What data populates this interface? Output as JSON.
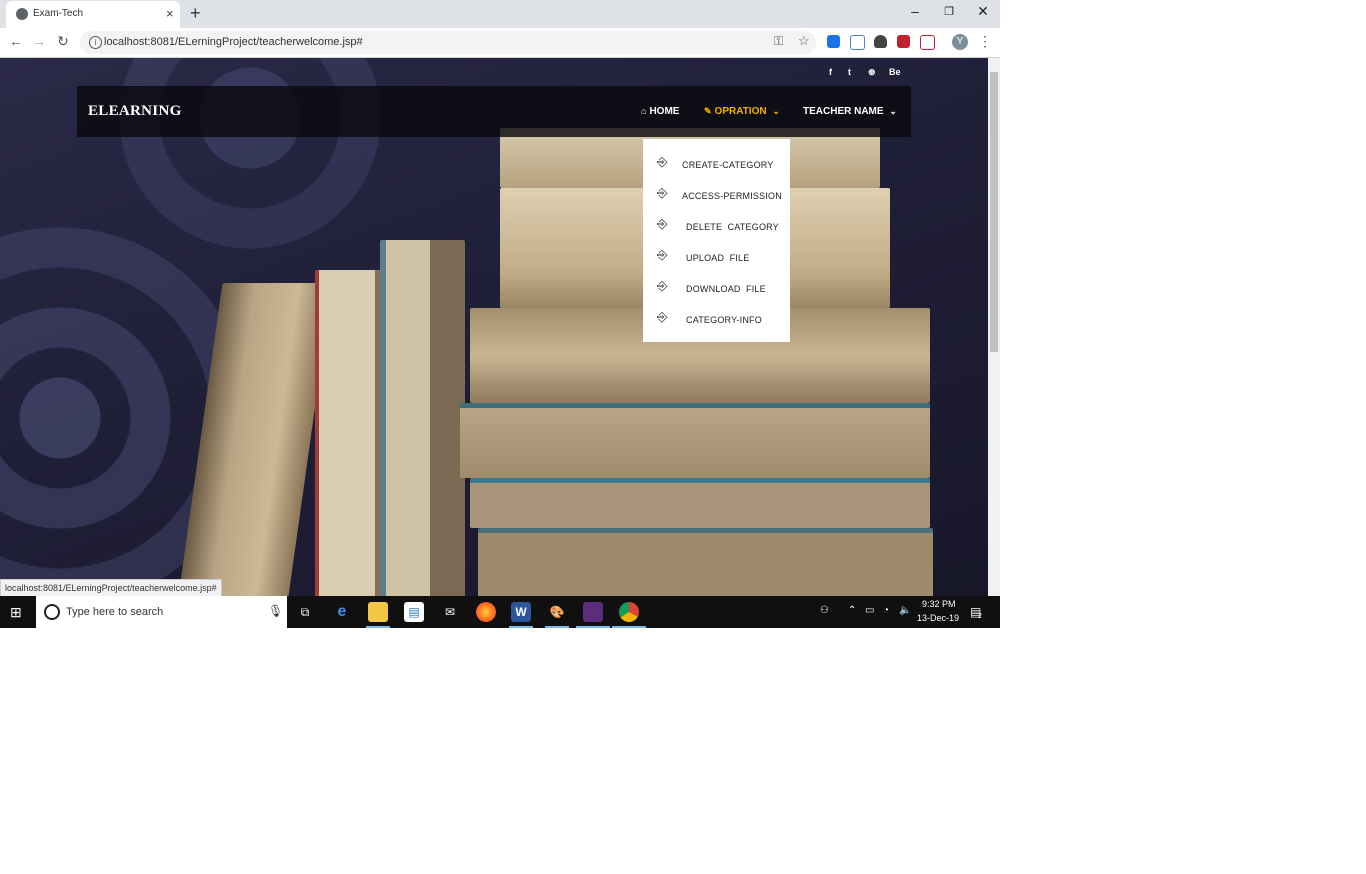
{
  "browser": {
    "tab_title": "Exam-Tech",
    "tab_close": "×",
    "new_tab": "+",
    "url": "localhost:8081/ELerningProject/teacherwelcome.jsp#",
    "status_url": "localhost:8081/ELerningProject/teacherwelcome.jsp#",
    "profile_initial": "Y",
    "window_controls": {
      "minimize": "–",
      "restore": "❐",
      "close": "✕"
    }
  },
  "site": {
    "social": [
      "f",
      "t",
      "⊛",
      "Be"
    ],
    "brand": "ELEARNING",
    "nav": {
      "home": "HOME",
      "operation": "OPRATION",
      "teacher": "TEACHER NAME"
    },
    "dropdown": [
      "CREATE-CATEGORY",
      "ACCESS-PERMISSION",
      "DELETE  CATEGORY",
      "UPLOAD  FILE",
      "DOWNLOAD  FILE",
      "CATEGORY-INFO"
    ]
  },
  "taskbar": {
    "search_placeholder": "Type here to search",
    "time": "9:32 PM",
    "date": "13-Dec-19",
    "notification_count": "2"
  },
  "colors": {
    "accent": "#f5b000",
    "navbar": "#0a0a0f"
  }
}
